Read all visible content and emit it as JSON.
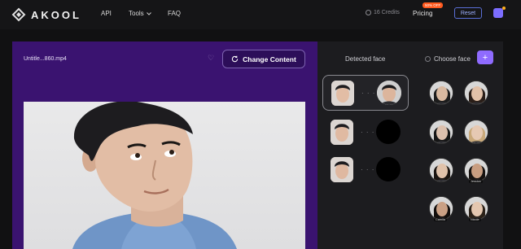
{
  "brand": {
    "name": "AKOOL"
  },
  "nav": {
    "api": "API",
    "tools": "Tools",
    "faq": "FAQ"
  },
  "header": {
    "credits": "16 Credits",
    "pricing": "Pricing",
    "pricing_badge": "50% OFF",
    "reset": "Reset"
  },
  "editor": {
    "filename": "Untitle...860.mp4",
    "change_content": "Change Content"
  },
  "faces": {
    "detected_label": "Detected face",
    "choose_label": "Choose face",
    "add_label": "+",
    "pair_dots": "· · ·",
    "choices": [
      {
        "name": "",
        "skin": "#d9b9a0",
        "hair": "#1c1c1c"
      },
      {
        "name": "",
        "skin": "#e2c1a8",
        "hair": "#2a1e18"
      },
      {
        "name": "",
        "skin": "#dcc0ad",
        "hair": "#151515"
      },
      {
        "name": "",
        "skin": "#e6c9b3",
        "hair": "#c9a97a"
      },
      {
        "name": "",
        "skin": "#e0c2aa",
        "hair": "#1a1410"
      },
      {
        "name": "Jessica",
        "skin": "#c89d80",
        "hair": "#161210"
      },
      {
        "name": "Camila",
        "skin": "#caa084",
        "hair": "#120e0c"
      },
      {
        "name": "Nicole",
        "skin": "#e4c7b0",
        "hair": "#2b2118"
      }
    ]
  },
  "colors": {
    "accent": "#8f6bff",
    "panel": "#3a1370",
    "badge": "#ff5a1f"
  }
}
